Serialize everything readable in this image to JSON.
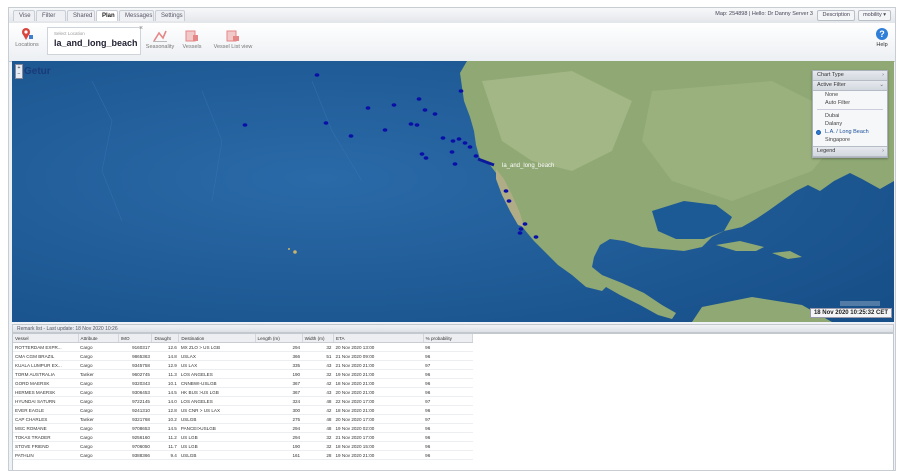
{
  "tabs": [
    "Vise",
    "Filter",
    "Shared",
    "Plan",
    "Messages",
    "Settings"
  ],
  "active_tab": "Plan",
  "top_right": {
    "info": "Map: 254898 | Hello: Dr Danny Server 3",
    "pill1": "Description",
    "pill2": "mobility ▾"
  },
  "ribbon": {
    "locations_label": "Locations",
    "selected_small": "Select Location",
    "selected_value": "la_and_long_beach",
    "btn1": "Seasonality",
    "btn2": "Vessels",
    "btn3": "Vessel List view",
    "help": "Help"
  },
  "map": {
    "search_label": "Getur",
    "port_label": "la_and_long_beach",
    "timestamp": "18 Nov 2020 10:25:32 CET"
  },
  "panel": {
    "chart_type": "Chart Type",
    "active_filter": "Active Filter",
    "items_top": [
      "None",
      "Auto Filter"
    ],
    "items_bottom": [
      "Dubai",
      "Dalany",
      "L.A. / Long Beach",
      "Singapore"
    ],
    "selected": "L.A. / Long Beach",
    "legend": "Legend"
  },
  "grid": {
    "header": "Remark list - Last update: 18 Nov 2020 10:26",
    "columns": [
      "Vessel",
      "Attribute",
      "IMO",
      "Draught",
      "Destination",
      "Length (m)",
      "Width (m)",
      "ETA",
      "% probability"
    ],
    "rows": [
      [
        "ROTTERDAM EXPR...",
        "Cargo",
        "9160317",
        "12.6",
        "MX ZLO > US LGB",
        "294",
        "32",
        "20 Nov 2020 13:00",
        "96"
      ],
      [
        "CMA CGM BRAZIL",
        "Cargo",
        "9865363",
        "14.8",
        "USLAX",
        "366",
        "51",
        "21 Nov 2020 09:00",
        "96"
      ],
      [
        "KUALA LUMPUR EX...",
        "Cargo",
        "9345758",
        "12.9",
        "US LAX",
        "335",
        "43",
        "21 Nov 2020 21:00",
        "97"
      ],
      [
        "TORM AUSTRALIA",
        "Tanker",
        "9602745",
        "11.3",
        "LOS ANGELES",
        "190",
        "32",
        "19 Nov 2020 21:00",
        "96"
      ],
      [
        "GORD MAERSK",
        "Cargo",
        "9320343",
        "10.1",
        "CNNBWI-USLGB",
        "367",
        "42",
        "18 Nov 2020 21:00",
        "96"
      ],
      [
        "HERMES MAERSK",
        "Cargo",
        "9306453",
        "14.5",
        "HK BUS >US LGB",
        "367",
        "43",
        "20 Nov 2020 21:00",
        "96"
      ],
      [
        "HYUNDAI SATURN",
        "Cargo",
        "9722145",
        "14.0",
        "LOS ANGELES",
        "324",
        "48",
        "22 Nov 2020 17:00",
        "97"
      ],
      [
        "EVER EAGLE",
        "Cargo",
        "9241310",
        "12.8",
        "US CNR > US LAX",
        "300",
        "42",
        "18 Nov 2020 21:00",
        "96"
      ],
      [
        "CAP CHARLES",
        "Tanker",
        "9321768",
        "10.2",
        "USLGB",
        "275",
        "48",
        "20 Nov 2020 17:00",
        "97"
      ],
      [
        "MSC ROMANE",
        "Cargo",
        "9708653",
        "14.5",
        "PANCEI>USLGB",
        "294",
        "48",
        "19 Nov 2020 02:00",
        "96"
      ],
      [
        "TOKAS TRADER",
        "Cargo",
        "9256160",
        "11.2",
        "US LGB",
        "294",
        "32",
        "21 Nov 2020 17:00",
        "96"
      ],
      [
        "STOVE FRIEND",
        "Cargo",
        "9706050",
        "11.7",
        "US LGB",
        "190",
        "32",
        "18 Nov 2020 15:00",
        "96"
      ],
      [
        "PATHLIN",
        "Cargo",
        "9388366",
        "9.4",
        "USLGB",
        "161",
        "28",
        "19 Nov 2020 21:00",
        "96"
      ]
    ]
  },
  "colors": {
    "ocean": "#1f5f9c",
    "land": "#9fb57e",
    "vessel": "#0a0fa8",
    "route": "#0b1a9a"
  }
}
